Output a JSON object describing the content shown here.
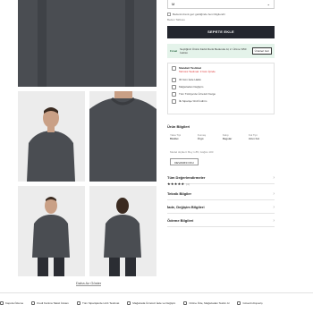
{
  "purchase": {
    "qty_value": "M",
    "qty_chevron": "⌄",
    "notify_text": "Bedenim/renk geri geldiğinde beni bilgilendir",
    "size_guide": "Beden Tablosu",
    "add_to_cart": "SEPETE EKLE"
  },
  "promo": {
    "tag": "Fırsat",
    "text": "Seçtiğiniz Ürünü Farklı Renk Bedende Al, 2. Ürüne %50 İndirim",
    "button": "Ürünleri Gör"
  },
  "info": {
    "standard_title": "Standart Teslimat",
    "standard_sub": "Tahmini Teslimat: 3 Gün İçinde",
    "items": [
      "30 Gün İade Hakkı",
      "Mağazadan Değişim",
      "Tüm Türkiye'de Ücretsiz Kargo",
      "İlk Siparişe %10 İndirim"
    ]
  },
  "product_info": {
    "title": "Ürün Bilgileri",
    "attrs": [
      {
        "label": "Yaka Tipi",
        "value": "Bisiklet"
      },
      {
        "label": "Kumaş",
        "value": "Örgü"
      },
      {
        "label": "Kalıp",
        "value": "Regular"
      },
      {
        "label": "Kol Tipi",
        "value": "Uzun Kol"
      }
    ],
    "description": "Model ölçüleri: Boy 1.85, Göğüs 100",
    "read_more": "DEVAMINI OKU"
  },
  "sections": {
    "reviews": "Tüm Değerlendirmeler",
    "stars": "★★★★★",
    "review_count": "(4)",
    "technical": "Teknik Bilgiler",
    "returns": "İade, Değişim Bilgileri",
    "payment": "Ödeme Bilgileri",
    "chevron": "›"
  },
  "gallery": {
    "show_less": "Daha Az Göster"
  },
  "strip": [
    "Kapıda Ödeme",
    "Kredi Kartına Taksit İmkanı",
    "Tüm Siparişlerde Hızlı Teslimat",
    "Mağazada Ücretsiz İade ve Değişim",
    "Online Öde, Mağazadan Teslim Al",
    "Güvenli Alışveriş"
  ],
  "colors": {
    "button_dark": "#23262e",
    "promo_bg": "#e4f3ea",
    "sweater": "#4a4d52"
  }
}
